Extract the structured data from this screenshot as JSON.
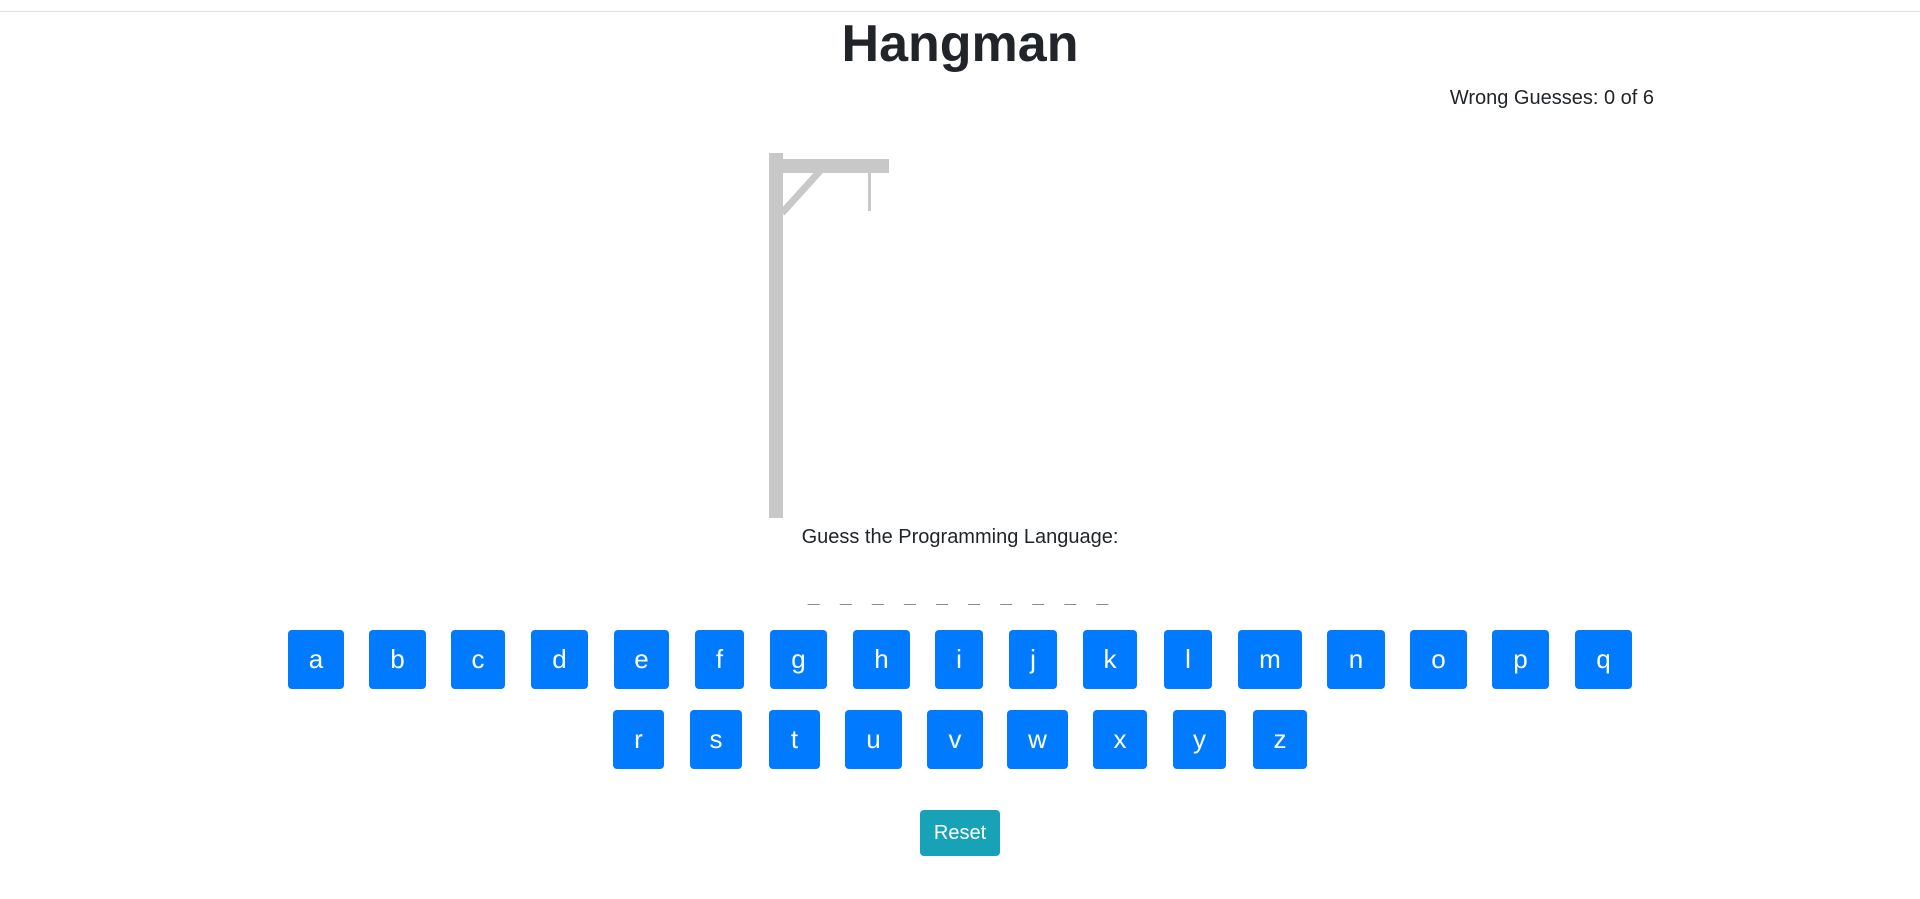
{
  "page": {
    "title": "Hangman",
    "wrong_guesses": "Wrong Guesses: 0 of 6",
    "wrong_guess_count": 0,
    "max_wrong_guesses": 6
  },
  "game": {
    "prompt": "Guess the Programming Language:",
    "word_blanks": "_ _ _ _ _ _ _ _ _ _"
  },
  "keyboard": {
    "row1": [
      "a",
      "b",
      "c",
      "d",
      "e",
      "f",
      "g",
      "h",
      "i",
      "j",
      "k",
      "l",
      "m",
      "n",
      "o",
      "p",
      "q"
    ],
    "row2": [
      "r",
      "s",
      "t",
      "u",
      "v",
      "w",
      "x",
      "y",
      "z"
    ]
  },
  "controls": {
    "reset_label": "Reset"
  },
  "colors": {
    "letter_button": "#007bff",
    "reset_button": "#17a2b8",
    "gallows": "#c8c8c8"
  }
}
